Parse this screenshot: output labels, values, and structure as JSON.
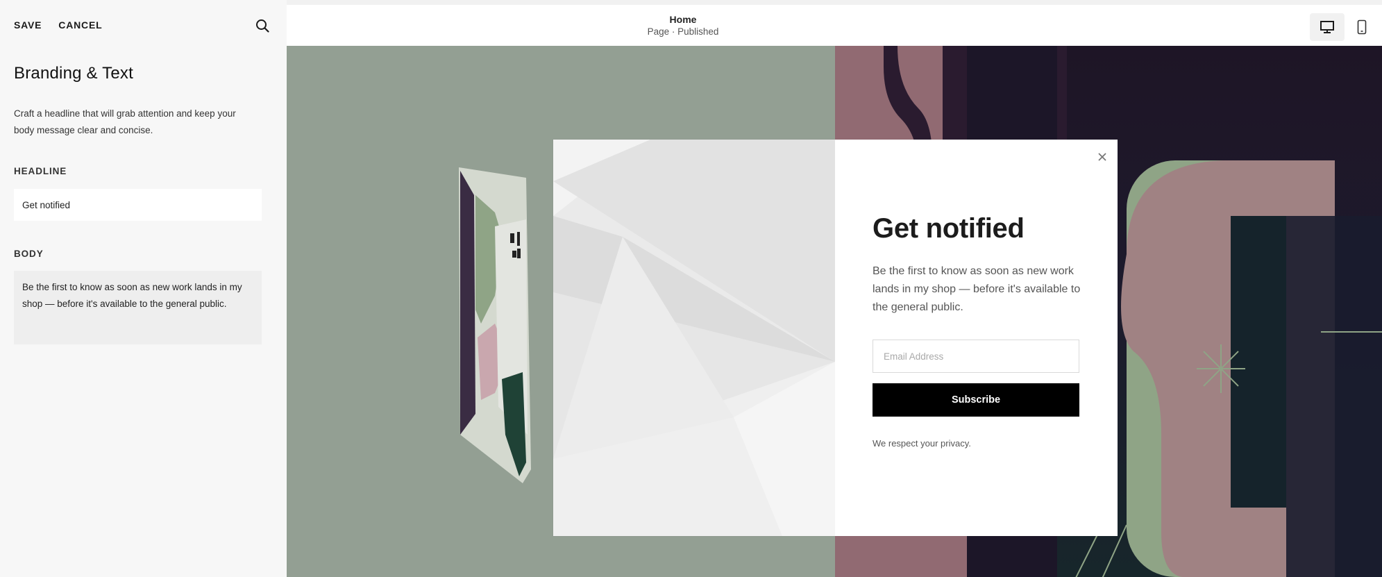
{
  "sidebar": {
    "save_label": "SAVE",
    "cancel_label": "CANCEL",
    "search_icon": "search-icon",
    "title": "Branding & Text",
    "description": "Craft a headline that will grab attention and keep your body message clear and concise.",
    "headline_label": "HEADLINE",
    "headline_value": "Get notified",
    "body_label": "BODY",
    "body_value": "Be the first to know as soon as new work lands in my shop — before it's available to the general public."
  },
  "topbar": {
    "page_title": "Home",
    "page_status": "Page · Published",
    "device_desktop_icon": "desktop-icon",
    "device_mobile_icon": "mobile-icon",
    "active_device": "desktop"
  },
  "popup": {
    "headline": "Get notified",
    "body": "Be the first to know as soon as new work lands in my shop — before it's available to the general public.",
    "email_placeholder": "Email Address",
    "email_value": "",
    "subscribe_label": "Subscribe",
    "privacy_text": "We respect your privacy.",
    "close_icon": "close-icon"
  },
  "colors": {
    "left_background": "#939f93",
    "right_background": "#1e1526",
    "pink_accent": "#a3787c",
    "green_accent": "#8fa486",
    "subscribe_button": "#000000"
  }
}
